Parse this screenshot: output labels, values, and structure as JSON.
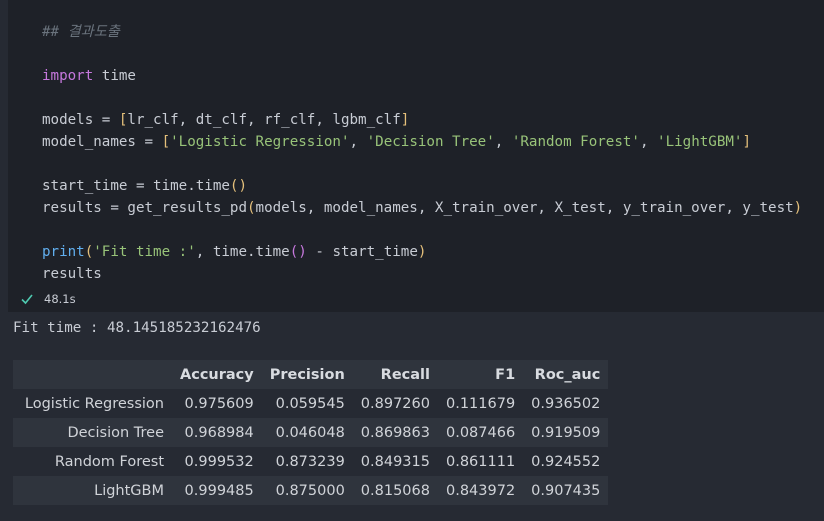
{
  "code": {
    "comment": "## 결과도출",
    "import_kw": "import",
    "import_mod": " time",
    "models_lhs": "models = ",
    "models_open": "[",
    "models_list": "lr_clf, dt_clf, rf_clf, lgbm_clf",
    "models_close": "]",
    "names_lhs": "model_names = ",
    "names_open": "[",
    "name_1": "'Logistic Regression'",
    "name_2": "'Decision Tree'",
    "name_3": "'Random Forest'",
    "name_4": "'LightGBM'",
    "sep": ", ",
    "names_close": "]",
    "start_lhs": "start_time = time.time",
    "start_parens": "()",
    "results_lhs": "results = get_results_pd",
    "results_open": "(",
    "results_args": "models, model_names, X_train_over, X_test, y_train_over, y_test",
    "results_close": ")",
    "print_fn": "print",
    "print_open": "(",
    "print_str": "'Fit time :'",
    "print_mid": ", time.time",
    "print_parens": "()",
    "print_rest": " - start_time",
    "print_close": ")",
    "results_var": "results"
  },
  "status": {
    "duration": "48.1s",
    "icon": "check-icon",
    "color": "#4ec9b0"
  },
  "output": {
    "stdout": "Fit time : 48.145185232162476",
    "table": {
      "columns": [
        "",
        "Accuracy",
        "Precision",
        "Recall",
        "F1",
        "Roc_auc"
      ],
      "rows": [
        {
          "index": "Logistic Regression",
          "values": [
            "0.975609",
            "0.059545",
            "0.897260",
            "0.111679",
            "0.936502"
          ]
        },
        {
          "index": "Decision Tree",
          "values": [
            "0.968984",
            "0.046048",
            "0.869863",
            "0.087466",
            "0.919509"
          ]
        },
        {
          "index": "Random Forest",
          "values": [
            "0.999532",
            "0.873239",
            "0.849315",
            "0.861111",
            "0.924552"
          ]
        },
        {
          "index": "LightGBM",
          "values": [
            "0.999485",
            "0.875000",
            "0.815068",
            "0.843972",
            "0.907435"
          ]
        }
      ]
    }
  }
}
